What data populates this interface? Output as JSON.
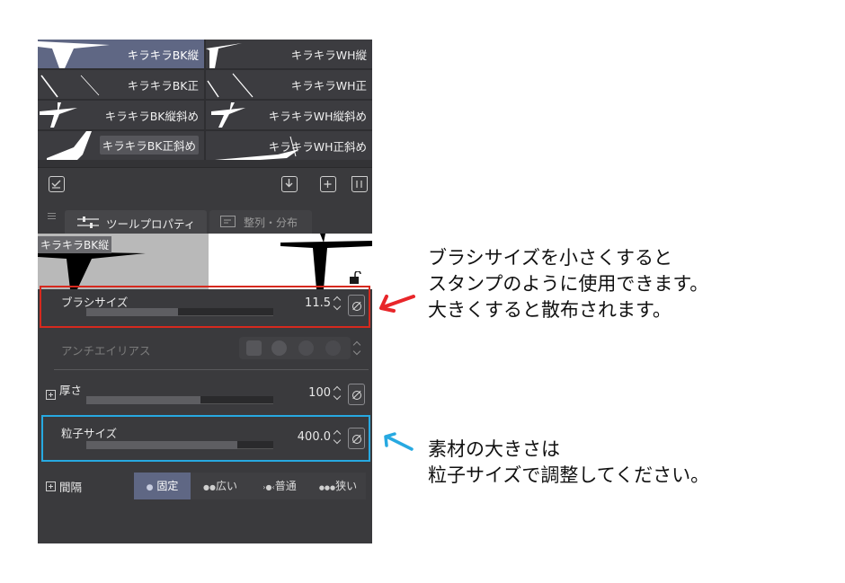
{
  "brushes": [
    {
      "label": "キラキラBK縦",
      "selected": true
    },
    {
      "label": "キラキラWH縦",
      "selected": false
    },
    {
      "label": "キラキラBK正",
      "selected": false
    },
    {
      "label": "キラキラWH正",
      "selected": false
    },
    {
      "label": "キラキラBK縦斜め",
      "selected": false
    },
    {
      "label": "キラキラWH縦斜め",
      "selected": false
    },
    {
      "label": "キラキラBK正斜め",
      "selected": false
    },
    {
      "label": "キラキラWH正斜め",
      "selected": false
    }
  ],
  "toolbar": {
    "left_icon": "brush-settings-icon",
    "right_icons": [
      "import-icon",
      "duplicate-icon",
      "trash-icon"
    ]
  },
  "tabs": [
    {
      "label": "ツールプロパティ",
      "active": true,
      "icon": "sliders-icon"
    },
    {
      "label": "整列・分布",
      "active": false,
      "icon": "align-icon"
    }
  ],
  "preview": {
    "brush_name": "キラキラBK縦",
    "lock_icon": "unlock-icon"
  },
  "properties": {
    "brush_size": {
      "label": "ブラシサイズ",
      "value": "11.5",
      "fill": 0.49
    },
    "antialias": {
      "label": "アンチエイリアス"
    },
    "thickness": {
      "label": "厚さ",
      "value": "100",
      "fill": 0.61
    },
    "particle_size": {
      "label": "粒子サイズ",
      "value": "400.0",
      "fill": 0.81
    },
    "interval": {
      "label": "間隔",
      "options": [
        {
          "label": "固定",
          "active": true
        },
        {
          "label": "広い",
          "active": false
        },
        {
          "label": "普通",
          "active": false
        },
        {
          "label": "狭い",
          "active": false
        }
      ]
    }
  },
  "annotations": {
    "red_note": [
      "ブラシサイズを小さくすると",
      "スタンプのように使用できます。",
      "大きくすると散布されます。"
    ],
    "blue_note": [
      "素材の大きさは",
      "粒子サイズで調整してください。"
    ],
    "red_color": "#e8262a",
    "blue_color": "#27a9e1"
  }
}
